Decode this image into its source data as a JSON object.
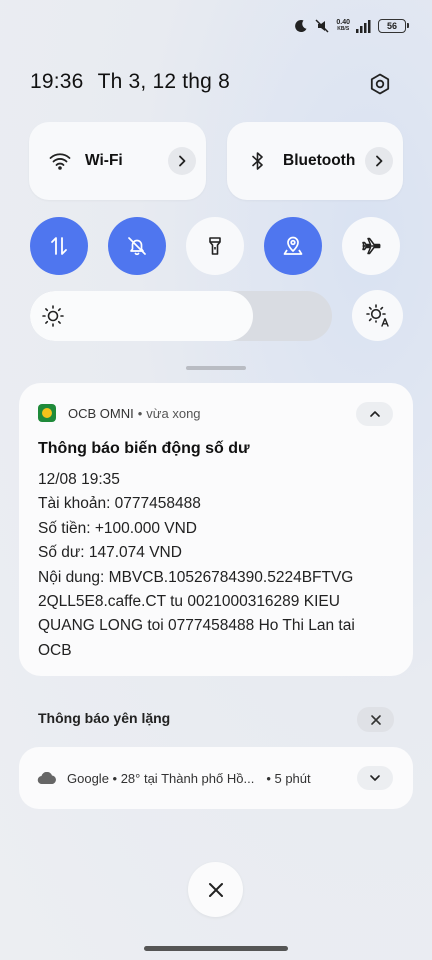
{
  "status_bar": {
    "net_speed_value": "0.40",
    "net_speed_unit": "KB/S",
    "battery": "56",
    "icons": [
      "moon-icon",
      "mute-vibrate-icon",
      "signal-icon",
      "battery-icon"
    ]
  },
  "header": {
    "time": "19:36",
    "date": "Th 3, 12 thg 8"
  },
  "tiles": {
    "wifi_label": "Wi-Fi",
    "bluetooth_label": "Bluetooth"
  },
  "toggles": [
    {
      "name": "mobile-data",
      "icon": "data-arrows-icon",
      "state": "on"
    },
    {
      "name": "do-not-disturb",
      "icon": "bell-off-icon",
      "state": "on"
    },
    {
      "name": "flashlight",
      "icon": "flashlight-icon",
      "state": "off"
    },
    {
      "name": "location",
      "icon": "location-icon",
      "state": "on"
    },
    {
      "name": "airplane-mode",
      "icon": "airplane-icon",
      "state": "off"
    }
  ],
  "brightness": {
    "level": 0.74
  },
  "notification": {
    "app_name": "OCB OMNI",
    "separator": "•",
    "time": "vừa xong",
    "title": "Thông báo biến động số dư",
    "lines": [
      "12/08 19:35",
      "Tài khoản: 0777458488",
      "Số tiền: +100.000 VND",
      "Số dư: 147.074 VND",
      "Nội dung: MBVCB.10526784390.5224BFTVG",
      "2QLL5E8.caffe.CT tu 0021000316289 KIEU",
      "QUANG LONG toi 0777458488 Ho Thi Lan tai",
      "OCB"
    ]
  },
  "silent": {
    "label": "Thông báo yên lặng"
  },
  "google_notification": {
    "text": "Google • 28° tại Thành phố Hồ...",
    "time": "• 5 phút"
  },
  "colors": {
    "accent": "#4f76ef",
    "tile_bg": "#f8f9fb",
    "background": "#eceef2"
  }
}
